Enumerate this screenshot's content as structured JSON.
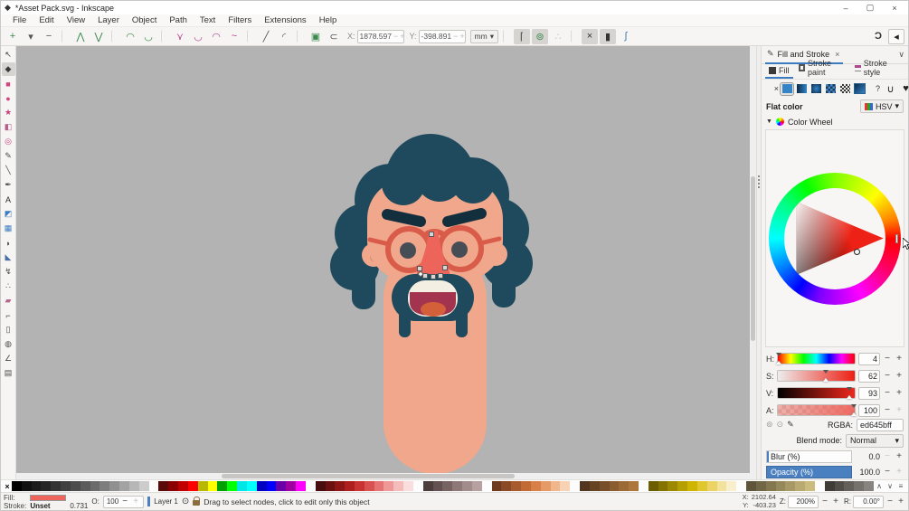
{
  "window": {
    "title": "*Asset Pack.svg - Inkscape",
    "app_icon": "◆",
    "minimize": "–",
    "maximize": "▢",
    "close": "×"
  },
  "menubar": {
    "items": [
      "File",
      "Edit",
      "View",
      "Layer",
      "Object",
      "Path",
      "Text",
      "Filters",
      "Extensions",
      "Help"
    ]
  },
  "cmdbar": {
    "icons_left": [
      {
        "name": "insert-node-button",
        "glyph": "+",
        "color": "#3c8a4e",
        "cls": "btn"
      },
      {
        "name": "insert-node-menu",
        "glyph": "▾",
        "color": "#555",
        "cls": "btn"
      },
      {
        "name": "delete-node-button",
        "glyph": "−",
        "color": "#555",
        "cls": "btn"
      },
      {
        "name": "separator",
        "glyph": "",
        "color": "",
        "cls": "sep"
      },
      {
        "name": "join-nodes-button",
        "glyph": "⋀",
        "color": "#3c8a4e",
        "cls": "btn"
      },
      {
        "name": "break-nodes-button",
        "glyph": "⋁",
        "color": "#3c8a4e",
        "cls": "btn"
      },
      {
        "name": "separator",
        "glyph": "",
        "color": "",
        "cls": "sep"
      },
      {
        "name": "join-with-segment-button",
        "glyph": "◠",
        "color": "#3c8a4e",
        "cls": "btn"
      },
      {
        "name": "delete-segment-button",
        "glyph": "◡",
        "color": "#3c8a4e",
        "cls": "btn"
      },
      {
        "name": "separator",
        "glyph": "",
        "color": "",
        "cls": "sep"
      },
      {
        "name": "node-corner-button",
        "glyph": "⋎",
        "color": "#b0478c",
        "cls": "btn"
      },
      {
        "name": "node-smooth-button",
        "glyph": "◡",
        "color": "#b0478c",
        "cls": "btn"
      },
      {
        "name": "node-symmetric-button",
        "glyph": "◠",
        "color": "#b0478c",
        "cls": "btn"
      },
      {
        "name": "node-auto-button",
        "glyph": "~",
        "color": "#b0478c",
        "cls": "btn"
      },
      {
        "name": "separator",
        "glyph": "",
        "color": "",
        "cls": "sep"
      },
      {
        "name": "segment-line-button",
        "glyph": "╱",
        "color": "#555",
        "cls": "btn"
      },
      {
        "name": "segment-curve-button",
        "glyph": "◜",
        "color": "#555",
        "cls": "btn"
      },
      {
        "name": "separator",
        "glyph": "",
        "color": "",
        "cls": "sep"
      },
      {
        "name": "object-to-path-button",
        "glyph": "▣",
        "color": "#3c8a4e",
        "cls": "btn"
      },
      {
        "name": "stroke-to-path-button",
        "glyph": "⊂",
        "color": "#555",
        "cls": "btn"
      }
    ],
    "x_field": {
      "label": "X:",
      "value": "1878.597",
      "minus": "−",
      "plus": "+"
    },
    "y_field": {
      "label": "Y:",
      "value": "-398.891",
      "minus": "−",
      "plus": "+"
    },
    "units": {
      "value": "mm",
      "chevron": "▾"
    },
    "toggles_a": [
      {
        "name": "edit-clipping-paths-toggle",
        "glyph": "⌈",
        "color": "#444",
        "cls": "btn pressed"
      },
      {
        "name": "edit-masks-toggle",
        "glyph": "⊚",
        "color": "#3c8a4e",
        "cls": "btn pressed"
      },
      {
        "name": "path-effects-toggle",
        "glyph": "∴",
        "color": "#4a7fb5",
        "cls": "btn disabled"
      }
    ],
    "toggles_b": [
      {
        "name": "show-transform-handles-toggle",
        "glyph": "×",
        "color": "#333",
        "cls": "btn pressed"
      },
      {
        "name": "show-bezier-handles-toggle",
        "glyph": "▮",
        "color": "#333",
        "cls": "btn pressed"
      },
      {
        "name": "show-path-outline-toggle",
        "glyph": "∫",
        "color": "#3a7bb5",
        "cls": "btn"
      }
    ],
    "snap_toggle": "Ɔ",
    "dock_collapse": "◂"
  },
  "toolbox": {
    "tools": [
      {
        "name": "selector-tool",
        "glyph": "↖",
        "color": "#3a3a3a",
        "state": ""
      },
      {
        "name": "node-tool",
        "glyph": "◆",
        "color": "#3a3a3a",
        "state": "active"
      },
      {
        "name": "rectangle-tool",
        "glyph": "■",
        "color": "#d4457f",
        "state": ""
      },
      {
        "name": "ellipse-tool",
        "glyph": "●",
        "color": "#d4457f",
        "state": ""
      },
      {
        "name": "star-tool",
        "glyph": "★",
        "color": "#c2427a",
        "state": ""
      },
      {
        "name": "box-3d-tool",
        "glyph": "◧",
        "color": "#b85c8a",
        "state": ""
      },
      {
        "name": "spiral-tool",
        "glyph": "◎",
        "color": "#c2427a",
        "state": ""
      },
      {
        "name": "pencil-tool",
        "glyph": "✎",
        "color": "#4a4a4a",
        "state": ""
      },
      {
        "name": "calligraphy-tool",
        "glyph": "╲",
        "color": "#4a4a4a",
        "state": ""
      },
      {
        "name": "pen-tool",
        "glyph": "✒",
        "color": "#4a4a4a",
        "state": ""
      },
      {
        "name": "text-tool",
        "glyph": "A",
        "color": "#2a2a2a",
        "state": ""
      },
      {
        "name": "gradient-tool",
        "glyph": "◩",
        "color": "#3b7bbf",
        "state": ""
      },
      {
        "name": "mesh-gradient-tool",
        "glyph": "▦",
        "color": "#3b7bbf",
        "state": ""
      },
      {
        "name": "dropper-tool",
        "glyph": "◗",
        "color": "#4a4a4a",
        "state": ""
      },
      {
        "name": "paint-bucket-tool",
        "glyph": "◣",
        "color": "#4a6fa5",
        "state": ""
      },
      {
        "name": "tweak-tool",
        "glyph": "↯",
        "color": "#4a4a4a",
        "state": ""
      },
      {
        "name": "spray-tool",
        "glyph": "∴",
        "color": "#4a4a4a",
        "state": ""
      },
      {
        "name": "eraser-tool",
        "glyph": "▰",
        "color": "#b06a8a",
        "state": ""
      },
      {
        "name": "connector-tool",
        "glyph": "⌐",
        "color": "#4a4a4a",
        "state": ""
      },
      {
        "name": "page-tool",
        "glyph": "▯",
        "color": "#4a4a4a",
        "state": ""
      },
      {
        "name": "zoom-tool",
        "glyph": "◍",
        "color": "#4a4a4a",
        "state": ""
      },
      {
        "name": "measure-tool",
        "glyph": "∠",
        "color": "#4a4a4a",
        "state": ""
      },
      {
        "name": "pages-tool",
        "glyph": "▤",
        "color": "#4a4a4a",
        "state": ""
      }
    ]
  },
  "artwork": {
    "colors": {
      "canvas_bg": "#b3b3b3",
      "hair": "#1f4a5d",
      "brow": "#132f3d",
      "skin": "#f1a78b",
      "ear_inner": "#dd8f70",
      "glasses": "#d95c4a",
      "nose": "#ed645b",
      "pupil": "#474d55",
      "teeth": "#f4efe3",
      "tongue": "#a33450",
      "tongue_center": "#d4603a",
      "node_fill": "#d6d6d6",
      "node_stroke": "#5a5a5a",
      "node_diamond": "#ffffff"
    }
  },
  "panel": {
    "title": "Fill and Stroke",
    "close": "×",
    "chevron": "∨",
    "tab_icon": "✎",
    "tabs": {
      "fill": "Fill",
      "stroke_paint": "Stroke paint",
      "stroke_style": "Stroke style"
    },
    "fill_types": [
      {
        "name": "paint-none-button",
        "cls": "none",
        "glyph": "×"
      },
      {
        "name": "paint-flat-button",
        "cls": "flat sel",
        "glyph": ""
      },
      {
        "name": "paint-linear-gradient-button",
        "cls": "lin",
        "glyph": ""
      },
      {
        "name": "paint-radial-gradient-button",
        "cls": "rad",
        "glyph": ""
      },
      {
        "name": "paint-pattern-button",
        "cls": "pat",
        "glyph": ""
      },
      {
        "name": "paint-swatch-button",
        "cls": "swa",
        "glyph": ""
      },
      {
        "name": "paint-mesh-button",
        "cls": "mesh",
        "glyph": ""
      },
      {
        "name": "paint-unknown-button",
        "cls": "unk",
        "glyph": "?"
      }
    ],
    "fill_rules": [
      {
        "name": "fill-rule-evenodd-button",
        "glyph": "∪"
      },
      {
        "name": "fill-rule-nonzero-button",
        "glyph": "♥"
      }
    ],
    "flat_color_label": "Flat color",
    "picker_mode": {
      "value": "HSV",
      "chevron": "▾"
    },
    "wheel": {
      "expander": "▼",
      "label": "Color Wheel"
    },
    "h": {
      "label": "H:",
      "value": "4",
      "marker": "left:1.1%"
    },
    "s": {
      "label": "S:",
      "value": "62",
      "marker": "left:62%"
    },
    "v": {
      "label": "V:",
      "value": "93",
      "marker": "left:93%"
    },
    "a": {
      "label": "A:",
      "value": "100",
      "marker": "left:99%"
    },
    "minus": "−",
    "plus": "+",
    "rgba": {
      "label": "RGBA:",
      "value": "ed645bff",
      "icon1": "⊚",
      "icon2": "⊙",
      "dropper": "✎"
    },
    "blend": {
      "label": "Blend mode:",
      "value": "Normal",
      "chevron": "▾"
    },
    "blur": {
      "label": "Blur (%)",
      "value": "0.0",
      "plus": "+",
      "minus": "−"
    },
    "opacity": {
      "label": "Opacity (%)",
      "value": "100.0",
      "minus": "−",
      "plus": "+"
    }
  },
  "palette": {
    "none_x": "×",
    "colors": [
      "#000000",
      "#111111",
      "#1c1c1c",
      "#262626",
      "#333333",
      "#404040",
      "#4d4d4d",
      "#5c5c5c",
      "#6b6b6b",
      "#7d7d7d",
      "#909090",
      "#a3a3a3",
      "#b7b7b7",
      "#cccccc",
      "",
      "#5b0a0a",
      "#8b0000",
      "#c00000",
      "#ff0000",
      "#b8b800",
      "#ffff00",
      "#00a000",
      "#00ff00",
      "#00e5e5",
      "#00ffff",
      "#0000c0",
      "#0000ff",
      "#6a00a8",
      "#a000a0",
      "#ff00ff",
      "",
      "#4a0d0d",
      "#6b1010",
      "#8c1616",
      "#ad1f1f",
      "#c83232",
      "#d95050",
      "#e57373",
      "#ee9898",
      "#f5bcbc",
      "#fadddd",
      "",
      "#4e3d3d",
      "#635050",
      "#786363",
      "#8d7777",
      "#a28b8b",
      "#b7a0a0",
      "",
      "#6e3a1f",
      "#8a4a26",
      "#a65a2e",
      "#c26a36",
      "#d88048",
      "#e69a67",
      "#f0b68c",
      "#f8d2b4",
      "",
      "#53361d",
      "#654323",
      "#775029",
      "#895d2f",
      "#9b6a35",
      "#ad773b",
      "",
      "#6b5d00",
      "#847300",
      "#9d8900",
      "#b69f00",
      "#cfb500",
      "#e0c72e",
      "#ebd465",
      "#f3e29c",
      "#f9efcd",
      "",
      "#5f553a",
      "#716645",
      "#837750",
      "#95885b",
      "#a79966",
      "#b9aa71",
      "#cbbb7c",
      "",
      "#3f3c37",
      "#514e49",
      "#63605b",
      "#75726d",
      "#87847f"
    ],
    "scroll_up": "∧",
    "scroll_down": "∨",
    "menu": "≡"
  },
  "statusbar": {
    "fill": {
      "label": "Fill:",
      "swatch_style": "background:#ed645b"
    },
    "stroke": {
      "label": "Stroke:",
      "value": "Unset",
      "width": "0.731"
    },
    "opacity": {
      "label": "O:",
      "value": "100",
      "minus": "−",
      "plus": "+"
    },
    "layer": {
      "label": "Layer 1",
      "eye": "⊙"
    },
    "message": "Drag to select nodes, click to edit only this object",
    "x": {
      "label": "X:",
      "value": "2102.64"
    },
    "y": {
      "label": "Y:",
      "value": "-403.23"
    },
    "zoom": {
      "label": "Z:",
      "value": "200%",
      "minus": "−",
      "plus": "+"
    },
    "rotation": {
      "label": "R:",
      "value": "0.00°",
      "minus": "−",
      "plus": "+"
    }
  }
}
